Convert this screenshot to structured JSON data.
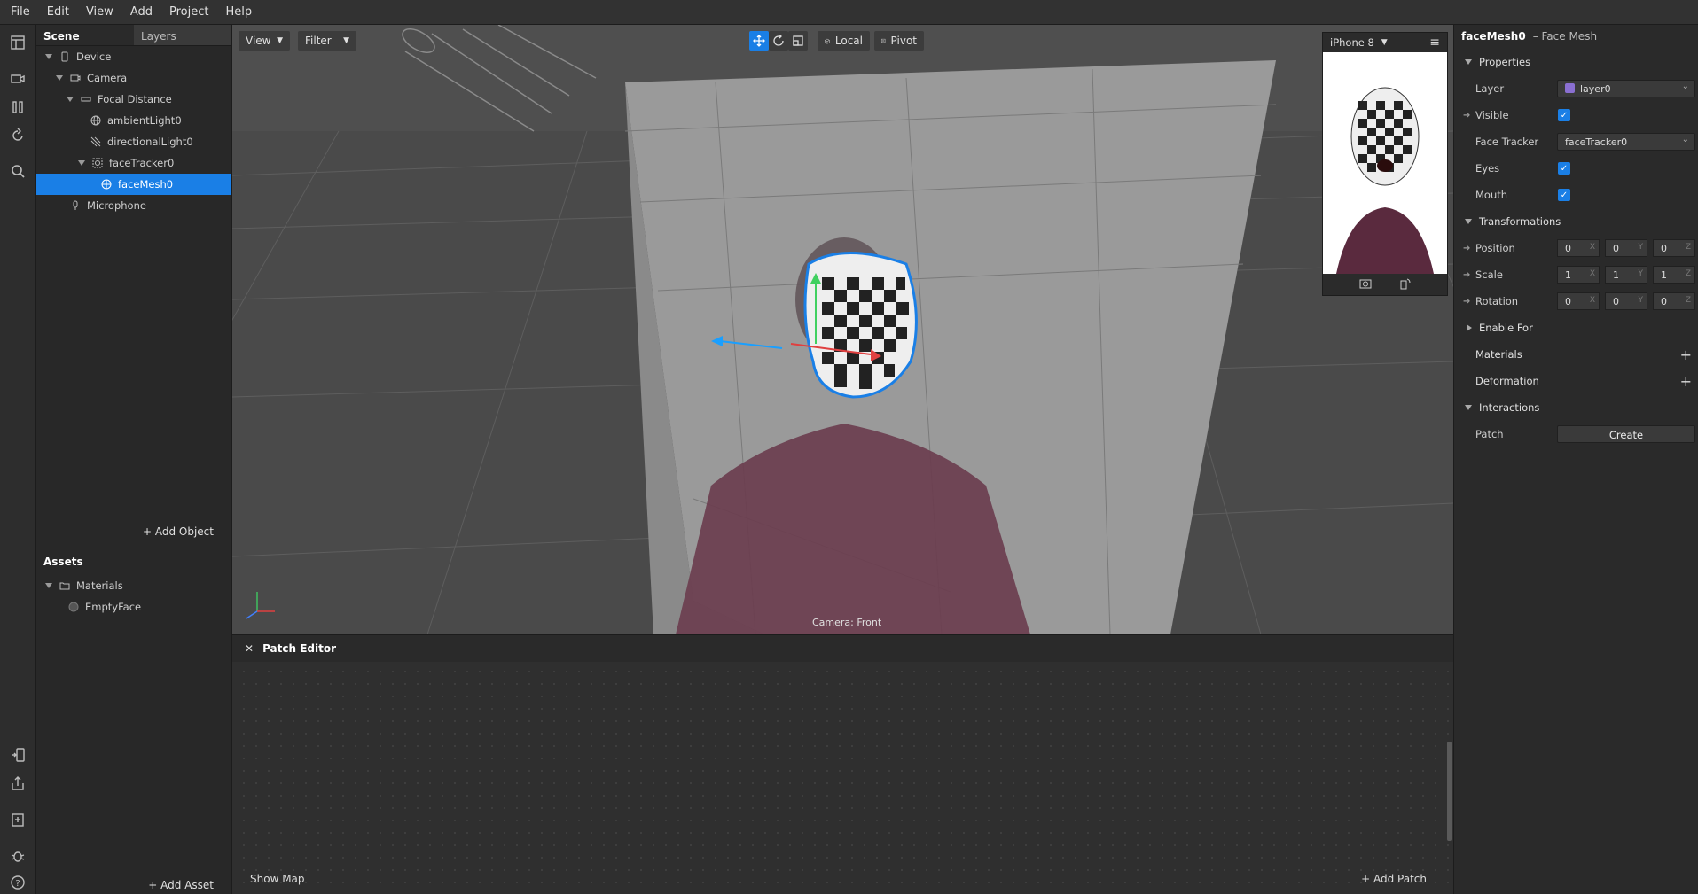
{
  "menu": [
    "File",
    "Edit",
    "View",
    "Add",
    "Project",
    "Help"
  ],
  "scene": {
    "tabs": [
      "Scene",
      "Layers"
    ],
    "tree": [
      {
        "label": "Device",
        "icon": "device-icon",
        "depth": 0,
        "expanded": true
      },
      {
        "label": "Camera",
        "icon": "camera-icon",
        "depth": 1,
        "expanded": true
      },
      {
        "label": "Focal Distance",
        "icon": "focal-distance-icon",
        "depth": 2,
        "expanded": true
      },
      {
        "label": "ambientLight0",
        "icon": "ambient-light-icon",
        "depth": 3,
        "expanded": false
      },
      {
        "label": "directionalLight0",
        "icon": "directional-light-icon",
        "depth": 3,
        "expanded": false
      },
      {
        "label": "faceTracker0",
        "icon": "face-tracker-icon",
        "depth": 3,
        "expanded": true
      },
      {
        "label": "faceMesh0",
        "icon": "face-mesh-icon",
        "depth": 4,
        "expanded": false,
        "selected": true
      },
      {
        "label": "Microphone",
        "icon": "microphone-icon",
        "depth": 1,
        "expanded": false
      }
    ],
    "add_object": "Add Object"
  },
  "assets": {
    "title": "Assets",
    "folder": "Materials",
    "items": [
      "EmptyFace"
    ],
    "add_asset": "Add Asset"
  },
  "viewport": {
    "view_label": "View",
    "filter_label": "Filter",
    "local_label": "Local",
    "pivot_label": "Pivot",
    "camera_label": "Camera: Front",
    "device": "iPhone 8"
  },
  "patch_editor": {
    "title": "Patch Editor",
    "show_map": "Show Map",
    "add_patch": "Add Patch"
  },
  "properties": {
    "object_name": "faceMesh0",
    "object_type": "– Face Mesh",
    "properties_section": "Properties",
    "layer_label": "Layer",
    "layer_value": "layer0",
    "layer_color": "#8a6fd1",
    "visible_label": "Visible",
    "face_tracker_label": "Face Tracker",
    "face_tracker_value": "faceTracker0",
    "eyes_label": "Eyes",
    "mouth_label": "Mouth",
    "transformations_section": "Transformations",
    "position_label": "Position",
    "position": [
      "0",
      "0",
      "0"
    ],
    "scale_label": "Scale",
    "scale": [
      "1",
      "1",
      "1"
    ],
    "rotation_label": "Rotation",
    "rotation": [
      "0",
      "0",
      "0"
    ],
    "axes": [
      "X",
      "Y",
      "Z"
    ],
    "enable_for": "Enable For",
    "materials": "Materials",
    "deformation": "Deformation",
    "interactions_section": "Interactions",
    "patch_label": "Patch",
    "create_label": "Create"
  },
  "colors": {
    "accent": "#1a7fe6"
  }
}
